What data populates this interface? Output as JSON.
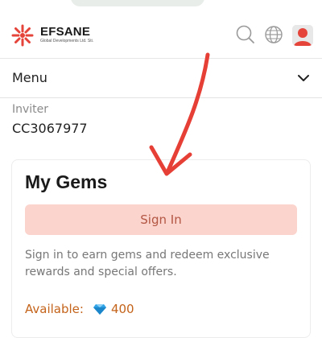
{
  "header": {
    "brand_name": "EFSANE",
    "brand_sub": "Global Developments Ltd. Sti.",
    "search_icon": "search-icon",
    "globe_icon": "globe-icon",
    "avatar_icon": "user-avatar-icon"
  },
  "menu": {
    "label": "Menu",
    "toggle_icon": "chevron-down-icon"
  },
  "inviter": {
    "label": "Inviter",
    "code": "CC3067977"
  },
  "gems": {
    "title": "My Gems",
    "sign_in_label": "Sign In",
    "description": "Sign in to earn gems and redeem exclusive rewards and special offers.",
    "available_label": "Available:",
    "available_value": "400",
    "gem_icon": "diamond-icon"
  },
  "colors": {
    "accent_red": "#e5443a",
    "signin_bg": "#fbd4cd",
    "available_text": "#c4631a",
    "annotation_arrow": "#e64036"
  }
}
